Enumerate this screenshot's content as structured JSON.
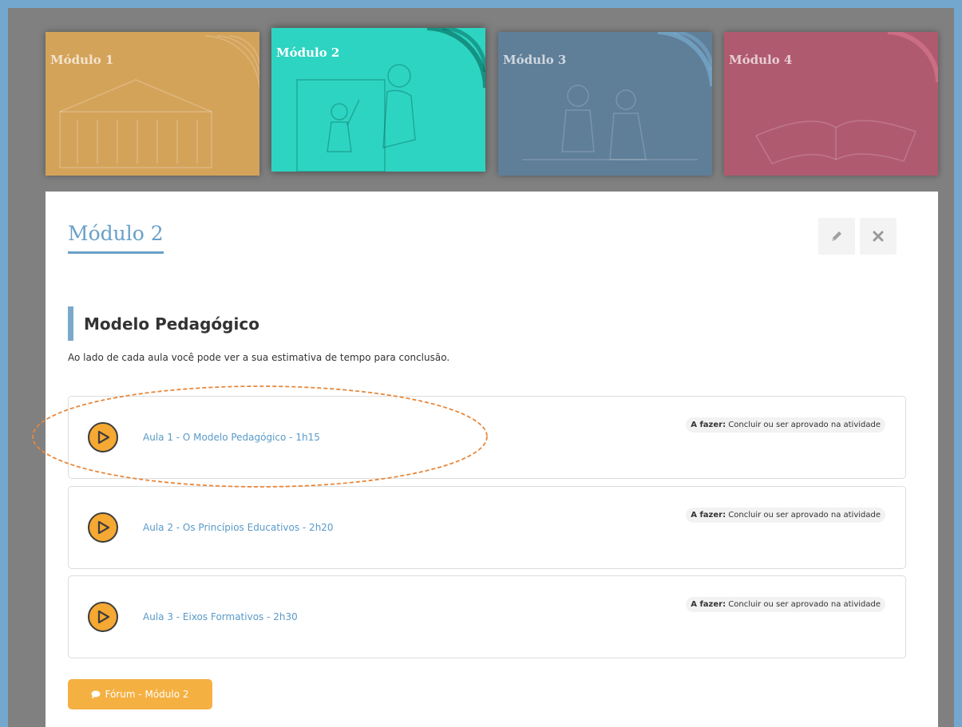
{
  "modules": [
    {
      "title": "Módulo 1",
      "color": "#d4a35a"
    },
    {
      "title": "Módulo 2",
      "color": "#2dd4c1"
    },
    {
      "title": "Módulo 3",
      "color": "#5f7e98"
    },
    {
      "title": "Módulo 4",
      "color": "#b05a70"
    }
  ],
  "panel": {
    "title": "Módulo 2",
    "edit_icon": "pencil-icon",
    "close_icon": "close-icon",
    "section_title": "Modelo Pedagógico",
    "section_description": "Ao lado de cada aula você pode ver a sua estimativa de tempo para conclusão."
  },
  "lessons": [
    {
      "label": "Aula 1 - O Modelo Pedagógico - 1h15",
      "status_prefix": "A fazer:",
      "status_text": " Concluir ou ser aprovado na atividade"
    },
    {
      "label": "Aula 2 - Os Princípios Educativos - 2h20",
      "status_prefix": "A fazer:",
      "status_text": " Concluir ou ser aprovado na atividade"
    },
    {
      "label": "Aula 3 - Eixos Formativos - 2h30",
      "status_prefix": "A fazer:",
      "status_text": " Concluir ou ser aprovado na atividade"
    }
  ],
  "forum": {
    "label": "Fórum - Módulo 2",
    "icon": "comment-icon",
    "color": "#f5b042"
  },
  "colors": {
    "accent": "#6aa0c8",
    "highlight": "#e8873a",
    "play": "#f5a832"
  }
}
